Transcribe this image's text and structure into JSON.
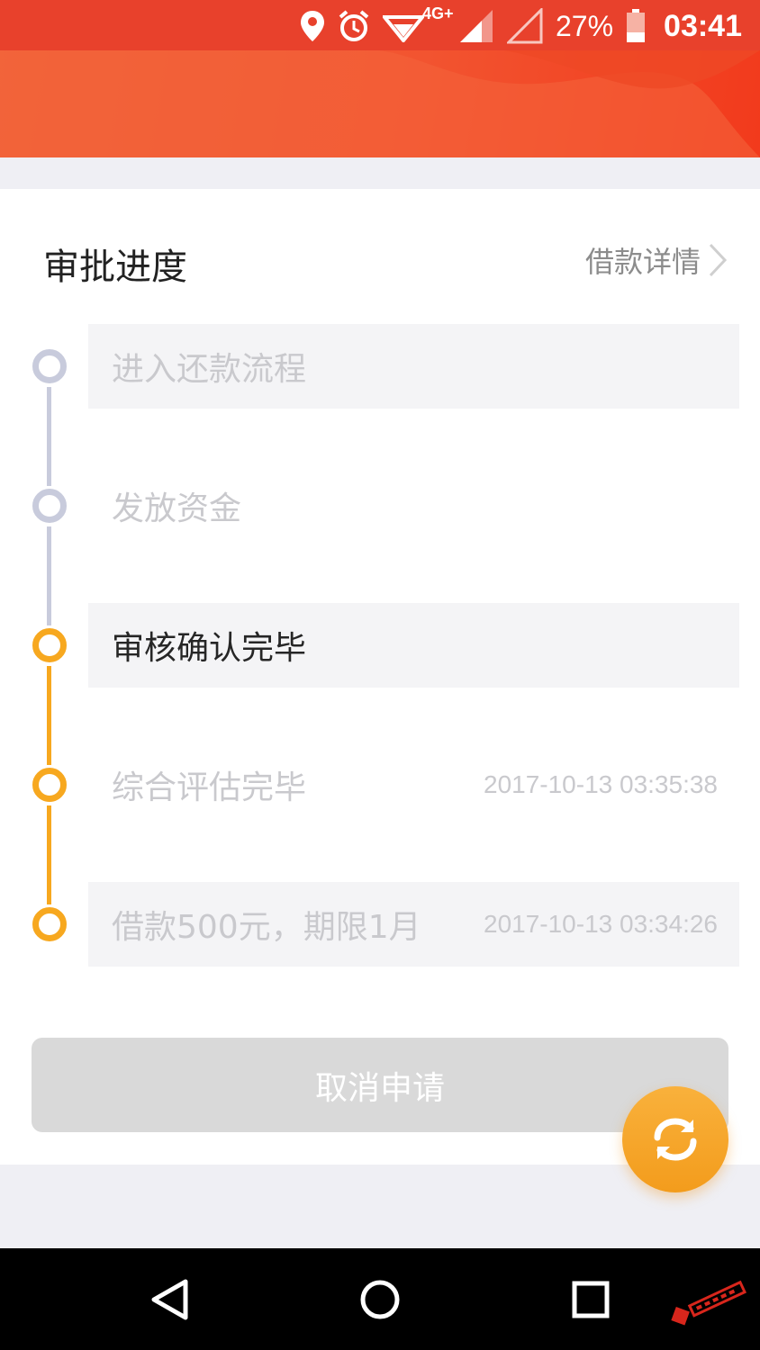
{
  "status_bar": {
    "battery_percent": "27%",
    "time": "03:41",
    "network": "4G+",
    "icons": [
      "location-icon",
      "alarm-icon",
      "wifi-icon",
      "signal-icon",
      "signal-empty-icon",
      "battery-icon"
    ]
  },
  "card": {
    "title": "审批进度",
    "detail_link": "借款详情"
  },
  "timeline": {
    "steps": [
      {
        "label": "进入还款流程",
        "time": "",
        "state": "pending"
      },
      {
        "label": "发放资金",
        "time": "",
        "state": "pending"
      },
      {
        "label": "审核确认完毕",
        "time": "",
        "state": "current"
      },
      {
        "label": "综合评估完毕",
        "time": "2017-10-13 03:35:38",
        "state": "done"
      },
      {
        "label": "借款500元，期限1月",
        "time": "2017-10-13 03:34:26",
        "state": "done"
      }
    ]
  },
  "actions": {
    "cancel_label": "取消申请"
  },
  "colors": {
    "header": "#f25430",
    "active": "#f7a81f",
    "inactive": "#c8cbdc"
  }
}
